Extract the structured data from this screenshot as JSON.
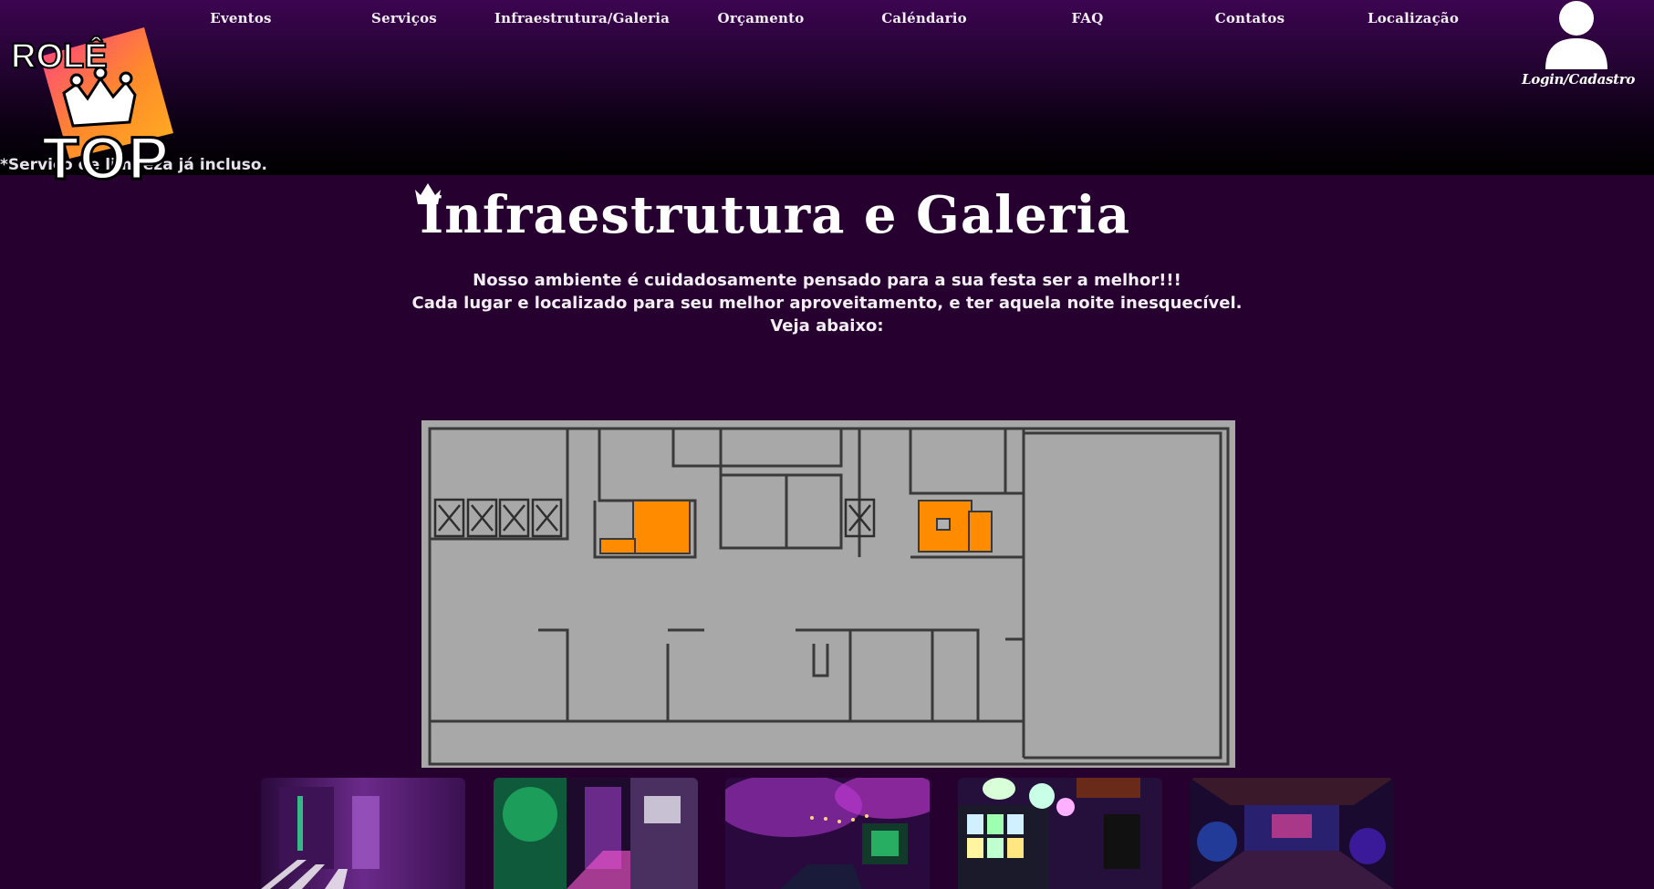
{
  "header": {
    "nav": [
      {
        "label": "Eventos"
      },
      {
        "label": "Serviços"
      },
      {
        "label": "Infraestrutura/Galeria"
      },
      {
        "label": "Orçamento"
      },
      {
        "label": "Caléndario"
      },
      {
        "label": "FAQ"
      },
      {
        "label": "Contatos"
      },
      {
        "label": "Localização"
      }
    ],
    "logo": {
      "line1": "ROLÊ",
      "line2": "TOP"
    },
    "service_note": "*Serviço de limpeza já incluso.",
    "login_label": "Login/Cadastro",
    "icons": {
      "login": "user-icon",
      "title": "crown-icon"
    }
  },
  "main": {
    "title": "Infraestrutura e Galeria",
    "intro": [
      "Nosso ambiente é cuidadosamente pensado para a sua festa ser a melhor!!!",
      "Cada lugar e localizado para seu melhor aproveitamento, e ter aquela noite inesquecível.",
      "Veja abaixo:"
    ],
    "gallery_count": 5
  },
  "colors": {
    "page_bg": "#26002f",
    "floorplan_bg": "#a8a8a8",
    "floorplan_highlight": "#ff8c00",
    "logo_orange": "#ff9a1f",
    "logo_pink": "#ff3d8a"
  }
}
